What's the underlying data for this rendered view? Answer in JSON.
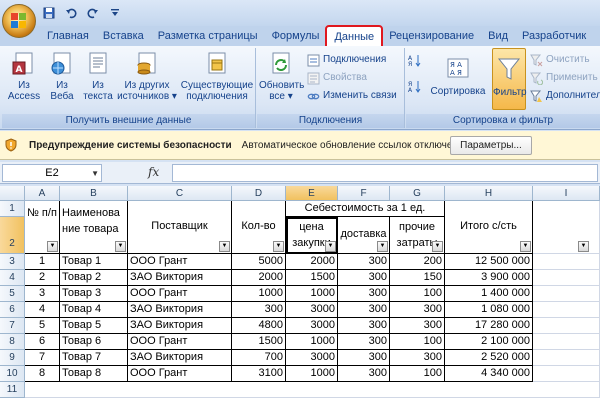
{
  "ribbon_tabs": [
    "Главная",
    "Вставка",
    "Разметка страницы",
    "Формулы",
    "Данные",
    "Рецензирование",
    "Вид",
    "Разработчик"
  ],
  "active_tab": "Данные",
  "groups": {
    "external": {
      "label": "Получить внешние данные",
      "buttons": [
        {
          "line1": "Из",
          "line2": "Access"
        },
        {
          "line1": "Из",
          "line2": "Веба"
        },
        {
          "line1": "Из",
          "line2": "текста"
        },
        {
          "line1": "Из других",
          "line2": "источников ▾"
        },
        {
          "line1": "Существующие",
          "line2": "подключения"
        }
      ]
    },
    "connections": {
      "label": "Подключения",
      "refresh": {
        "line1": "Обновить",
        "line2": "все ▾"
      },
      "items": [
        "Подключения",
        "Свойства",
        "Изменить связи"
      ]
    },
    "sort_filter": {
      "label": "Сортировка и фильтр",
      "sort": "Сортировка",
      "filter": "Фильтр",
      "items": [
        "Очистить",
        "Применить п",
        "Дополнител"
      ]
    }
  },
  "security": {
    "title": "Предупреждение системы безопасности",
    "message": "Автоматическое обновление ссылок отключено",
    "button": "Параметры..."
  },
  "formula_bar": {
    "name_box": "E2",
    "fx": "fx",
    "content": ""
  },
  "columns": [
    "A",
    "B",
    "C",
    "D",
    "E",
    "F",
    "G",
    "H",
    "I"
  ],
  "rows": [
    "1",
    "2",
    "3",
    "4",
    "5",
    "6",
    "7",
    "8",
    "9",
    "10",
    "11"
  ],
  "header": {
    "num": "№ п/п",
    "name": "Наименова ние товара",
    "supplier": "Поставщик",
    "qty": "Кол-во",
    "cost_group": "Себестоимость за 1 ед.",
    "price": "цена закупки",
    "delivery": "доставка",
    "other": "прочие затраты",
    "total": "Итого с/сть"
  },
  "table": [
    {
      "n": "1",
      "name": "Товар 1",
      "supplier": "ООО Грант",
      "qty": "5000",
      "price": "2000",
      "delivery": "300",
      "other": "200",
      "total": "12 500 000"
    },
    {
      "n": "2",
      "name": "Товар 2",
      "supplier": "ЗАО Виктория",
      "qty": "2000",
      "price": "1500",
      "delivery": "300",
      "other": "150",
      "total": "3 900 000"
    },
    {
      "n": "3",
      "name": "Товар 3",
      "supplier": "ООО Грант",
      "qty": "1000",
      "price": "1000",
      "delivery": "300",
      "other": "100",
      "total": "1 400 000"
    },
    {
      "n": "4",
      "name": "Товар 4",
      "supplier": "ЗАО Виктория",
      "qty": "300",
      "price": "3000",
      "delivery": "300",
      "other": "300",
      "total": "1 080 000"
    },
    {
      "n": "5",
      "name": "Товар 5",
      "supplier": "ЗАО Виктория",
      "qty": "4800",
      "price": "3000",
      "delivery": "300",
      "other": "300",
      "total": "17 280 000"
    },
    {
      "n": "6",
      "name": "Товар 6",
      "supplier": "ООО Грант",
      "qty": "1500",
      "price": "1000",
      "delivery": "300",
      "other": "100",
      "total": "2 100 000"
    },
    {
      "n": "7",
      "name": "Товар 7",
      "supplier": "ЗАО Виктория",
      "qty": "700",
      "price": "3000",
      "delivery": "300",
      "other": "300",
      "total": "2 520 000"
    },
    {
      "n": "8",
      "name": "Товар 8",
      "supplier": "ООО Грант",
      "qty": "3100",
      "price": "1000",
      "delivery": "300",
      "other": "100",
      "total": "4 340 000"
    }
  ],
  "qat_icons": [
    "save-icon",
    "undo-icon",
    "redo-icon",
    "customize-icon"
  ],
  "colors": {
    "accent": "#15428b",
    "highlight": "#e0181f",
    "filter_active": "#f5b84a"
  }
}
